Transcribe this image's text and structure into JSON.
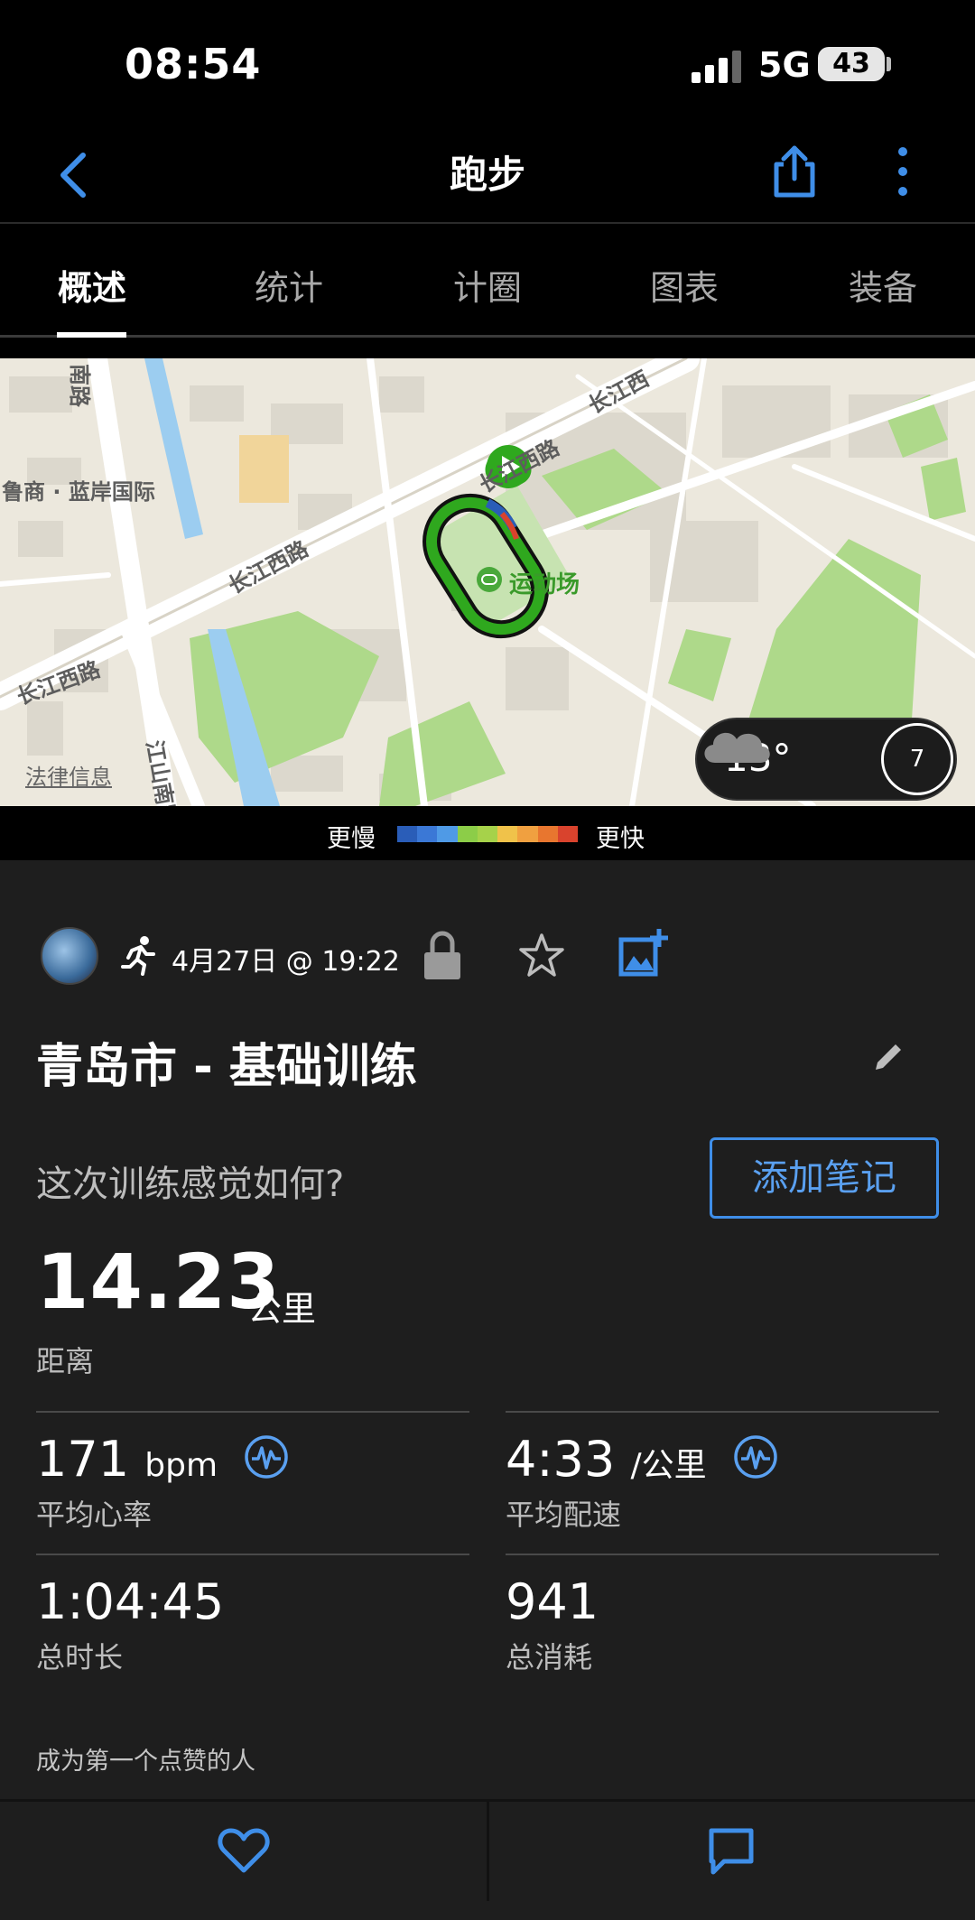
{
  "status_bar": {
    "time": "08:54",
    "network": "5G",
    "battery": "43"
  },
  "header": {
    "title": "跑步"
  },
  "tabs": [
    {
      "label": "概述",
      "active": true
    },
    {
      "label": "统计",
      "active": false
    },
    {
      "label": "计圈",
      "active": false
    },
    {
      "label": "图表",
      "active": false
    },
    {
      "label": "装备",
      "active": false
    }
  ],
  "map": {
    "labels": {
      "road_changjiang_west_1": "长江西路",
      "road_changjiang_west_2": "长江西路",
      "road_changjiang_west_3": "长江西路",
      "road_changjiang_west_4": "长江西",
      "road_nan": "南路",
      "road_jiangshan_nan": "江山南路",
      "poi_lushang": "鲁商 · 蓝岸国际",
      "poi_stadium": "运动场"
    },
    "legal": "法律信息",
    "weather": {
      "temperature": "13°",
      "wind": "7"
    }
  },
  "pace_legend": {
    "slower": "更慢",
    "faster": "更快",
    "colors": [
      "#2a5db8",
      "#3b78d6",
      "#4f9ae6",
      "#8ccd48",
      "#a6d24a",
      "#f0c24a",
      "#f0a040",
      "#e8762f",
      "#d9432d"
    ]
  },
  "activity": {
    "date": "4月27日 @ 19:22",
    "title": "青岛市 - 基础训练",
    "feel_question": "这次训练感觉如何?",
    "add_note": "添加笔记",
    "distance": {
      "value": "14.23",
      "unit": "公里",
      "label": "距离"
    },
    "avg_hr": {
      "value": "171",
      "unit": "bpm",
      "label": "平均心率"
    },
    "avg_pace": {
      "value": "4:33",
      "unit": "/公里",
      "label": "平均配速"
    },
    "duration": {
      "value": "1:04:45",
      "label": "总时长"
    },
    "calories": {
      "value": "941",
      "label": "总消耗"
    },
    "likes": "成为第一个点赞的人"
  },
  "colors": {
    "accent": "#3f8ee8",
    "route": "#2d8a1e",
    "background": "#1e1e1e"
  }
}
